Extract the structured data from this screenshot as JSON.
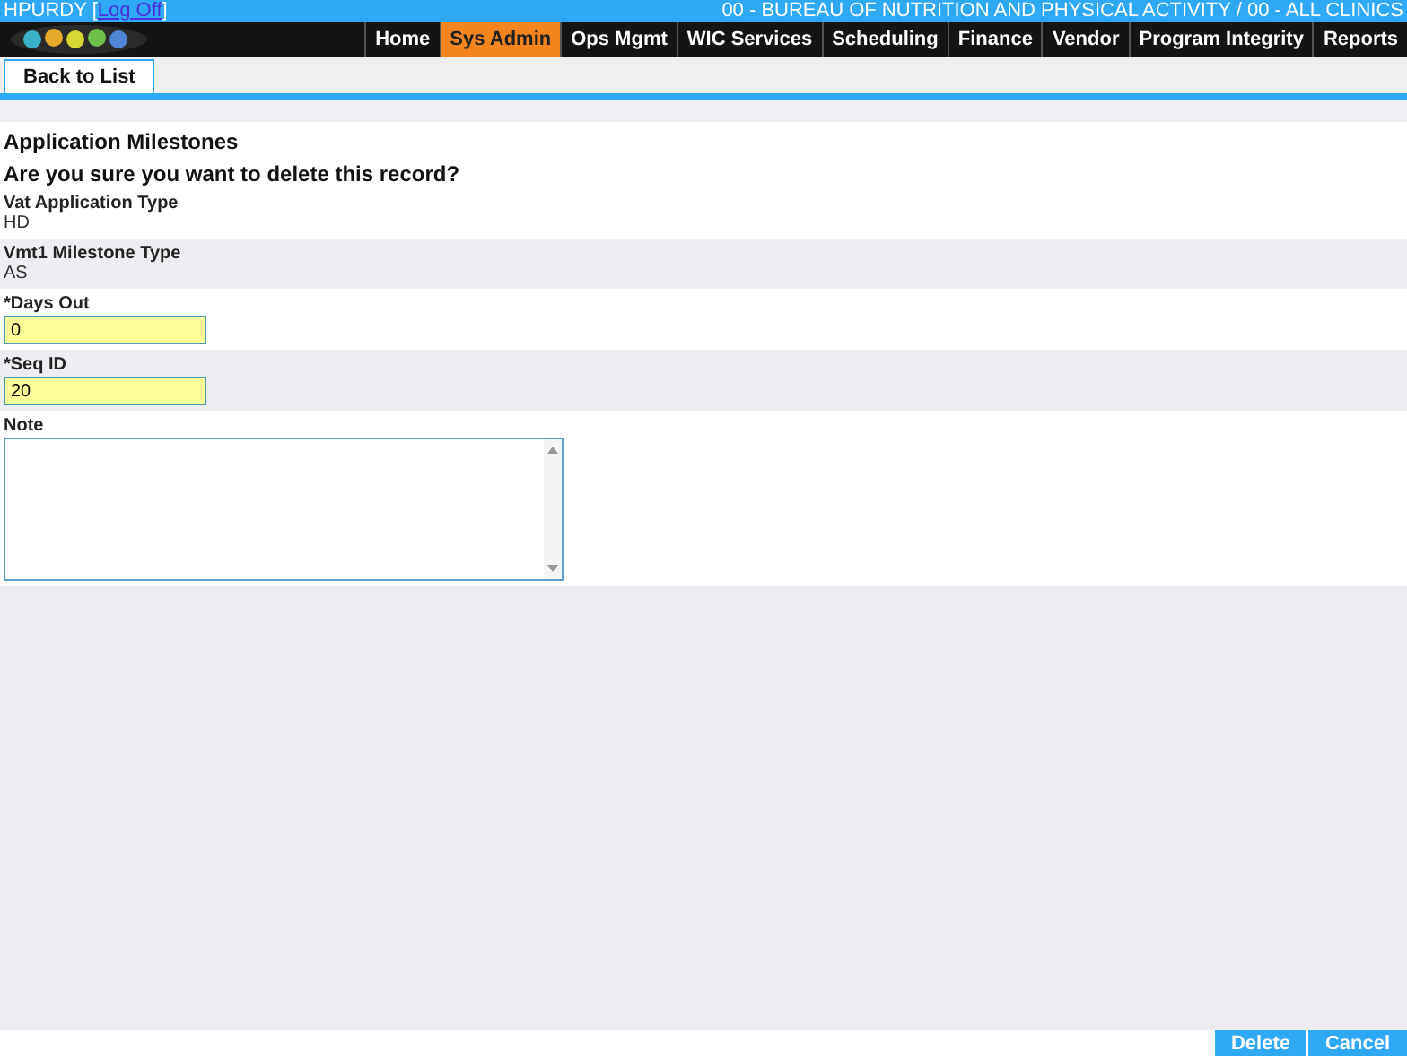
{
  "user_bar": {
    "user": "HPURDY",
    "open_bracket": "[",
    "logoff_link": "Log Off",
    "close_bracket": "]",
    "agency": "00 - BUREAU OF NUTRITION AND PHYSICAL ACTIVITY / 00 - ALL CLINICS"
  },
  "nav": [
    {
      "label": "Home",
      "selected": false
    },
    {
      "label": "Sys Admin",
      "selected": true
    },
    {
      "label": "Ops Mgmt",
      "selected": false
    },
    {
      "label": "WIC Services",
      "selected": false
    },
    {
      "label": "Scheduling",
      "selected": false
    },
    {
      "label": "Finance",
      "selected": false
    },
    {
      "label": "Vendor",
      "selected": false
    },
    {
      "label": "Program Integrity",
      "selected": false
    },
    {
      "label": "Reports",
      "selected": false
    }
  ],
  "tabs": [
    {
      "label": "Back to List",
      "selected": true
    }
  ],
  "page_title": "Application Milestones",
  "confirm_message": "Are you sure you want to delete this record?",
  "fields": [
    {
      "kind": "readonly",
      "label": "Vat Application Type",
      "value": "HD"
    },
    {
      "kind": "readonly",
      "label": "Vmt1 Milestone Type",
      "value": "AS"
    },
    {
      "kind": "input",
      "label": "*Days Out",
      "value": "0"
    },
    {
      "kind": "input",
      "label": "*Seq ID",
      "value": "20"
    },
    {
      "kind": "textarea",
      "label": "Note"
    }
  ],
  "buttons": [
    "Delete",
    "Cancel"
  ]
}
